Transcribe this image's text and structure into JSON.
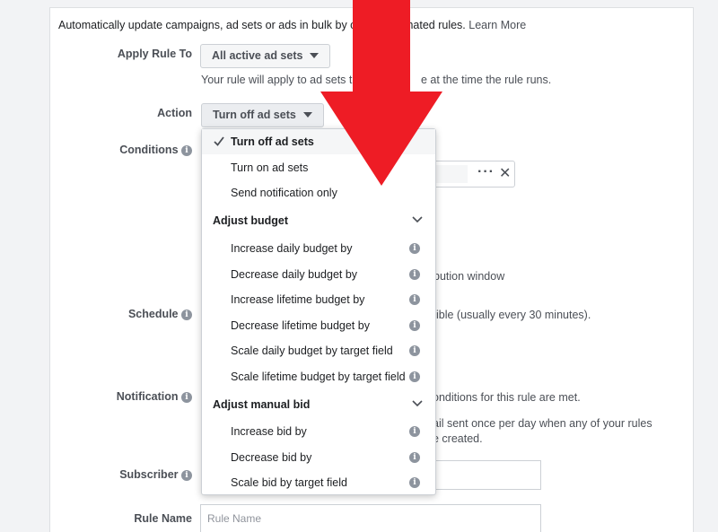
{
  "intro": {
    "text": "Automatically update campaigns, ad sets or ads in bulk by c",
    "text_tail": "mated rules.",
    "learn_more": "Learn More"
  },
  "apply_rule": {
    "label": "Apply Rule To",
    "value": "All active ad sets",
    "help": "Your rule will apply to ad sets t",
    "help_tail": "e at the time the rule runs."
  },
  "action": {
    "label": "Action",
    "value": "Turn off ad sets"
  },
  "conditions": {
    "label": "Conditions"
  },
  "attribution_tail": "bution window",
  "schedule": {
    "label": "Schedule",
    "tail": "ible (usually every 30 minutes)."
  },
  "notification": {
    "label": "Notification",
    "tail1": "onditions for this rule are met.",
    "tail2": "ail sent once per day when any of your rules",
    "tail3": "e created."
  },
  "subscriber": {
    "label": "Subscriber"
  },
  "rule_name": {
    "label": "Rule Name",
    "placeholder": "Rule Name"
  },
  "dropdown": {
    "items": [
      {
        "label": "Turn off ad sets",
        "selected": true
      },
      {
        "label": "Turn on ad sets"
      },
      {
        "label": "Send notification only"
      }
    ],
    "budget_group": "Adjust budget",
    "budget_items": [
      "Increase daily budget by",
      "Decrease daily budget by",
      "Increase lifetime budget by",
      "Decrease lifetime budget by",
      "Scale daily budget by target field",
      "Scale lifetime budget by target field"
    ],
    "bid_group": "Adjust manual bid",
    "bid_items": [
      "Increase bid by",
      "Decrease bid by",
      "Scale bid by target field"
    ]
  },
  "icons": {
    "info": "info-icon",
    "check": "check-icon",
    "chevron": "chevron-down-icon",
    "more": "more-icon",
    "close": "close-icon",
    "arrow": "red-arrow-down"
  },
  "colors": {
    "arrow": "#ee1c25",
    "accent": "#4267b2",
    "muted": "#4b4f56"
  }
}
